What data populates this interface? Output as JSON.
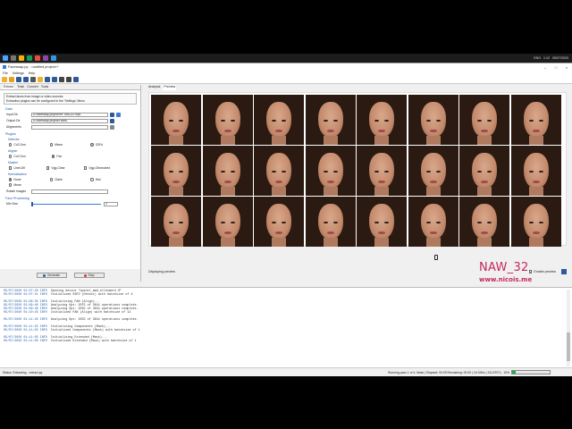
{
  "taskbar": {
    "tray_lang": "ENG",
    "clock_time": "1:12",
    "clock_date": "05/07/2020"
  },
  "titlebar": {
    "title": "Faceswap.py - <untitled project>*"
  },
  "menubar": {
    "items": [
      "File",
      "Settings",
      "Help"
    ]
  },
  "left": {
    "tabs": [
      "Extract",
      "Train",
      "Convert",
      "Tools"
    ],
    "info_line1": "Extract faces from image or video sources.",
    "info_line2": "Extraction plugins can be configured in the 'Settings' Menu",
    "data_title": "Data",
    "input_label": "Input Dir",
    "input_value": "D:/faceswap-project/WP MNL2Lr.mp4",
    "output_label": "Output Dir",
    "output_value": "D:/faceswap-project/FaceA",
    "alignments_label": "Alignments",
    "alignments_value": "",
    "plugins_title": "Plugins",
    "detector_title": "Detector",
    "detector_options": [
      "Cv2-Dnn",
      "Mtcnn",
      "S3Fd"
    ],
    "aligner_title": "Aligner",
    "aligner_options": [
      "Cv2-Dnn",
      "Fan"
    ],
    "masker_title": "Masker",
    "masker_options": [
      "Unet-Dfl",
      "Vgg-Clear",
      "Vgg-Obstructed"
    ],
    "normalization_title": "Normalization",
    "normalization_options": [
      "None",
      "Clahe",
      "Hist",
      "Mean"
    ],
    "rotate_label": "Rotate Images",
    "face_processing_title": "Face Processing",
    "min_size_label": "Min Size",
    "min_size_value": "0",
    "generate_label": "Generate",
    "stop_label": "Stop"
  },
  "right": {
    "tabs": [
      "Analysis",
      "Preview"
    ],
    "displaying_label": "Displaying preview",
    "enable_preview_label": "Enable preview"
  },
  "log": {
    "lines": [
      [
        "05/07/2020 01:07:20 INFO",
        "Opening device \"opencl_amd_ellesmere.0\""
      ],
      [
        "05/07/2020 01:07:21 INFO",
        "Initialized S3FD (Detect) with batchsize of 4"
      ],
      [
        "",
        ""
      ],
      [
        "05/07/2020 01:09:35 INFO",
        "Initializing FAN (Align)..."
      ],
      [
        "05/07/2020 01:09:40 INFO",
        "Analyzing Ops: 2075 of 3641 operations complete."
      ],
      [
        "05/07/2020 01:09:46 INFO",
        "Analyzing Ops: 2025 of 3641 operations complete."
      ],
      [
        "05/07/2020 01:10:45 INFO",
        "Initialized FAN (Align) with batchsize of 12"
      ],
      [
        "",
        ""
      ],
      [
        "05/07/2020 01:11:45 INFO",
        "Analyzing Ops: 2555 of 3641 operations complete."
      ],
      [
        "",
        ""
      ],
      [
        "05/07/2020 01:11:02 INFO",
        "Initializing Components (Mask)..."
      ],
      [
        "05/07/2020 01:11:02 INFO",
        "Initialized Components (Mask) with batchsize of 1"
      ],
      [
        "",
        ""
      ],
      [
        "05/07/2020 01:11:05 INFO",
        "Initializing Extended (Mask)..."
      ],
      [
        "05/07/2020 01:11:05 INFO",
        "Initialized Extended (Mask) with batchsize of 1"
      ]
    ]
  },
  "watermark": {
    "title": "NAW_32",
    "url": "www.nicois.me"
  },
  "status": {
    "left": "Status: Extracting - extract.py",
    "right": "Running pass 1 of 4: Mask  |  Elapsed: 00:09  Remaining: 00:00  |  16.02it/s  |  311/2972  |  ",
    "percent": "10%",
    "progress_fraction": 0.1
  }
}
